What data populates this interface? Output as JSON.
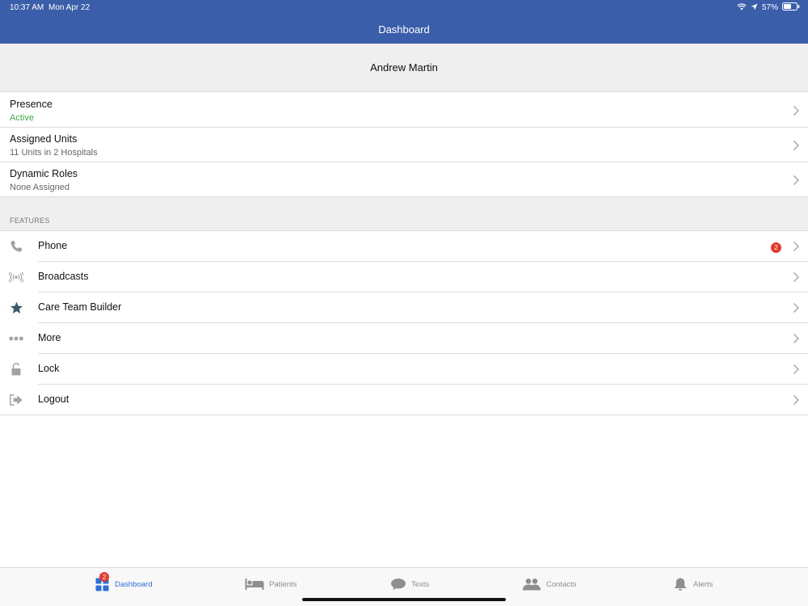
{
  "status_bar": {
    "time": "10:37 AM",
    "date": "Mon Apr 22",
    "battery": "57%",
    "icons": [
      "wifi-icon",
      "location-icon",
      "battery-icon"
    ]
  },
  "header": {
    "title": "Dashboard"
  },
  "user": {
    "name": "Andrew Martin"
  },
  "info_rows": [
    {
      "label": "Presence",
      "value": "Active"
    },
    {
      "label": "Assigned Units",
      "value": "11 Units in 2 Hospitals"
    },
    {
      "label": "Dynamic Roles",
      "value": "None Assigned"
    }
  ],
  "features": {
    "section_label": "FEATURES",
    "items": [
      {
        "label": "Phone",
        "icon": "phone-icon",
        "badge": "2"
      },
      {
        "label": "Broadcasts",
        "icon": "broadcast-icon"
      },
      {
        "label": "Care Team Builder",
        "icon": "star-icon"
      },
      {
        "label": "More",
        "icon": "more-dots-icon"
      },
      {
        "label": "Lock",
        "icon": "lock-icon"
      },
      {
        "label": "Logout",
        "icon": "logout-icon"
      }
    ]
  },
  "tabbar": {
    "tabs": [
      {
        "label": "Dashboard",
        "icon": "dashboard-icon",
        "badge": "2",
        "selected": true
      },
      {
        "label": "Patients",
        "icon": "bed-icon"
      },
      {
        "label": "Texts",
        "icon": "chat-bubble-icon"
      },
      {
        "label": "Contacts",
        "icon": "contacts-icon"
      },
      {
        "label": "Alerts",
        "icon": "bell-icon"
      }
    ]
  },
  "colors": {
    "header_bg": "#3a5ea9",
    "active_green": "#3fa847",
    "badge_red": "#e23b2e",
    "tab_selected": "#2f6fd6",
    "star_icon": "#3b5c68"
  }
}
